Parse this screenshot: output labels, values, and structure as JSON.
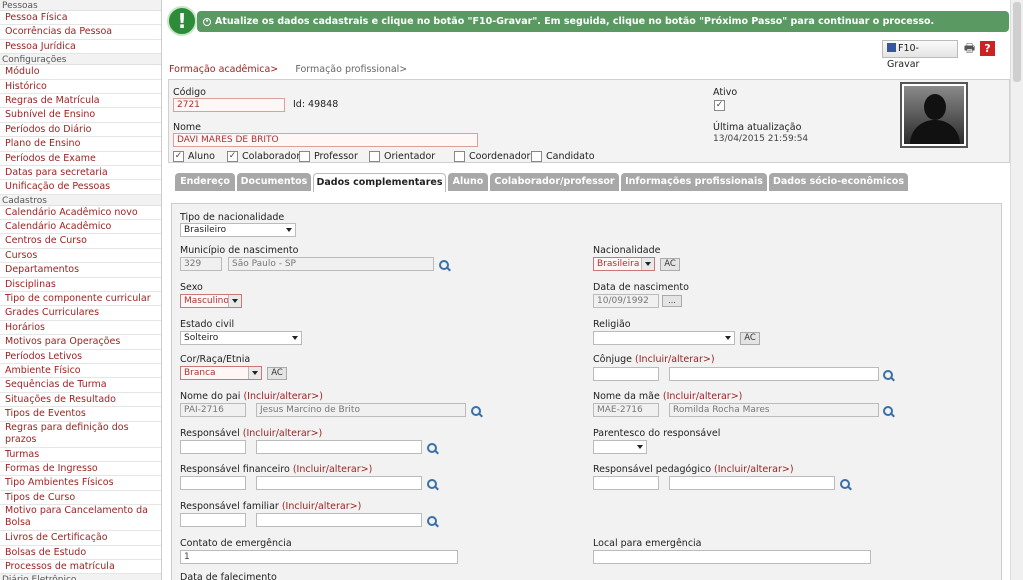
{
  "sidebar": {
    "sections": [
      {
        "title": "Pessoas",
        "items": [
          "Pessoa Física",
          "Ocorrências da Pessoa",
          "Pessoa Jurídica"
        ]
      },
      {
        "title": "Configurações",
        "items": [
          "Módulo",
          "Histórico",
          "Regras de Matrícula",
          "Subnível de Ensino",
          "Períodos do Diário",
          "Plano de Ensino",
          "Períodos de Exame",
          "Datas para secretaria",
          "Unificação de Pessoas"
        ]
      },
      {
        "title": "Cadastros",
        "items": [
          "Calendário Acadêmico novo",
          "Calendário Acadêmico",
          "Centros de Curso",
          "Cursos",
          "Departamentos",
          "Disciplinas",
          "Tipo de componente curricular",
          "Grades Curriculares",
          "Horários",
          "Motivos para Operações",
          "Períodos Letivos",
          "Ambiente Físico",
          "Sequências de Turma",
          "Situações de Resultado",
          "Tipos de Eventos",
          "Regras para definição dos prazos",
          "Turmas",
          "Formas de Ingresso",
          "Tipo Ambientes Físicos",
          "Tipos de Curso",
          "Motivo para Cancelamento da Bolsa",
          "Livros de Certificação",
          "Bolsas de Estudo",
          "Processos de matrícula"
        ]
      }
    ],
    "footer_partial": "Diário Eletrônico"
  },
  "alert": {
    "icon": "!",
    "text": "Atualize os dados cadastrais e clique no botão \"F10-Gravar\". Em seguida, clique no botão \"Próximo Passo\" para continuar o processo."
  },
  "toolbar": {
    "save_label": "F10-Gravar"
  },
  "breadcrumb": {
    "item1": "Formação acadêmica>",
    "item2": "Formação profissional>"
  },
  "header": {
    "codigo_label": "Código",
    "codigo_value": "2721",
    "id_text": "Id: 49848",
    "nome_label": "Nome",
    "nome_value": "DAVI MARES DE BRITO",
    "ativo_label": "Ativo",
    "ativo_checked": "✓",
    "ultima_label": "Última atualização",
    "ultima_value": "13/04/2015 21:59:54",
    "roles": [
      {
        "label": "Aluno",
        "checked": "✓"
      },
      {
        "label": "Colaborador",
        "checked": "✓"
      },
      {
        "label": "Professor",
        "checked": ""
      },
      {
        "label": "Orientador",
        "checked": ""
      },
      {
        "label": "Coordenador",
        "checked": ""
      },
      {
        "label": "Candidato",
        "checked": ""
      }
    ]
  },
  "tabs": [
    "Endereço",
    "Documentos",
    "Dados complementares",
    "Aluno",
    "Colaborador/professor",
    "Informações profissionais",
    "Dados sócio-econômicos"
  ],
  "form": {
    "tipo_nac_label": "Tipo de nacionalidade",
    "tipo_nac_value": "Brasileiro",
    "municipio_label": "Município de nascimento",
    "municipio_code": "329",
    "municipio_value": "São Paulo - SP",
    "nacionalidade_label": "Nacionalidade",
    "nacionalidade_value": "Brasileira",
    "ac": "AC",
    "sexo_label": "Sexo",
    "sexo_value": "Masculino",
    "data_nasc_label": "Data de nascimento",
    "data_nasc_value": "10/09/1992",
    "dots": "...",
    "estado_civil_label": "Estado civil",
    "estado_civil_value": "Solteiro",
    "religiao_label": "Religião",
    "cor_label": "Cor/Raça/Etnia",
    "cor_value": "Branca",
    "conjuge_label": "Cônjuge",
    "incluir": "(Incluir/alterar>)",
    "pai_label": "Nome do pai",
    "pai_code": "PAI-2716",
    "pai_value": "Jesus Marcino de Brito",
    "mae_label": "Nome da mãe",
    "mae_code": "MAE-2716",
    "mae_value": "Romilda Rocha Mares",
    "responsavel_label": "Responsável",
    "parentesco_label": "Parentesco do responsável",
    "resp_fin_label": "Responsável financeiro",
    "resp_ped_label": "Responsável pedagógico",
    "resp_fam_label": "Responsável familiar",
    "contato_label": "Contato de emergência",
    "contato_value": "1",
    "local_label": "Local para emergência",
    "falecimento_label": "Data de falecimento"
  }
}
